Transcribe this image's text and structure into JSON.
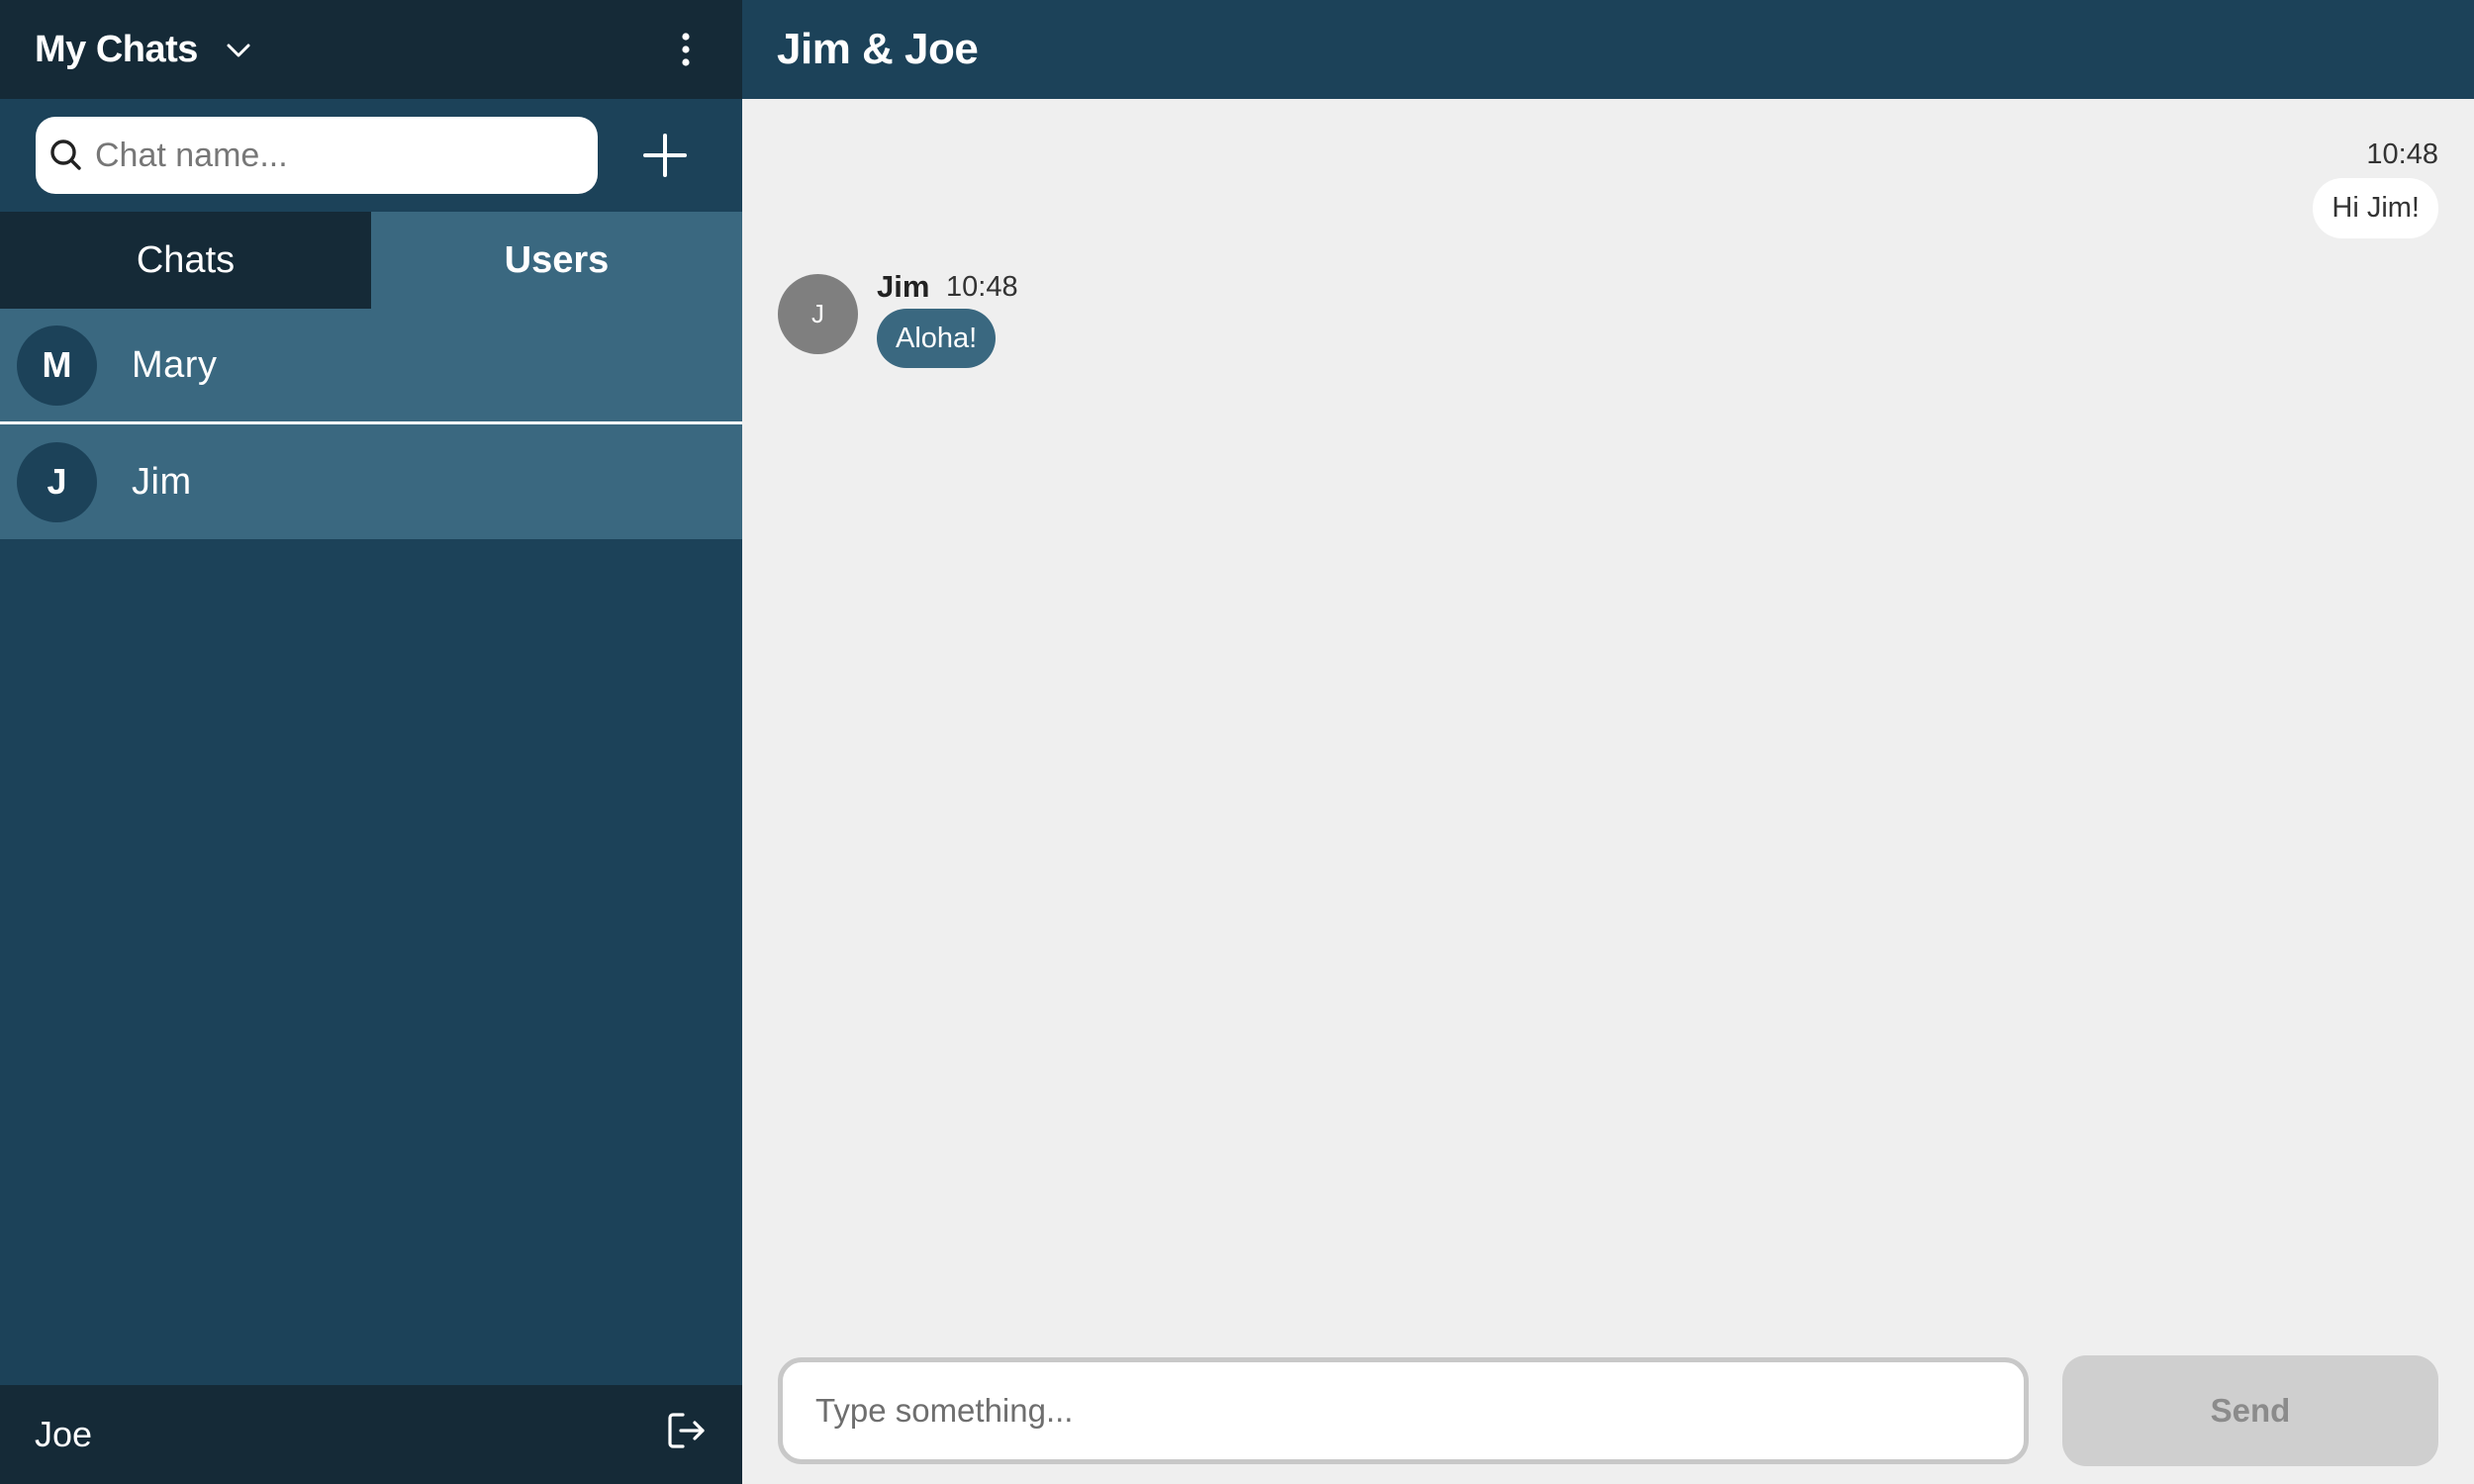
{
  "sidebar": {
    "title": "My Chats",
    "search": {
      "placeholder": "Chat name...",
      "value": ""
    },
    "tabs": [
      {
        "label": "Chats",
        "active": false
      },
      {
        "label": "Users",
        "active": true
      }
    ],
    "users": [
      {
        "initial": "M",
        "name": "Mary"
      },
      {
        "initial": "J",
        "name": "Jim"
      }
    ],
    "footer": {
      "current_user": "Joe"
    },
    "icons": [
      "chevron-down-icon",
      "kebab-menu-icon",
      "search-icon",
      "plus-icon",
      "logout-icon"
    ]
  },
  "chat": {
    "title": "Jim & Joe",
    "messages": [
      {
        "direction": "outgoing",
        "time": "10:48",
        "text": "Hi Jim!"
      },
      {
        "direction": "incoming",
        "sender": "Jim",
        "avatar_initial": "J",
        "time": "10:48",
        "text": "Aloha!"
      }
    ],
    "composer": {
      "placeholder": "Type something...",
      "value": "",
      "send_label": "Send",
      "send_enabled": false
    }
  },
  "colors": {
    "dark_navy": "#152a37",
    "navy": "#1c4259",
    "accent_blue": "#3a6880",
    "chat_background": "#efefef",
    "avatar_gray": "#7f7f7f",
    "send_disabled": "#cfcfcf"
  }
}
